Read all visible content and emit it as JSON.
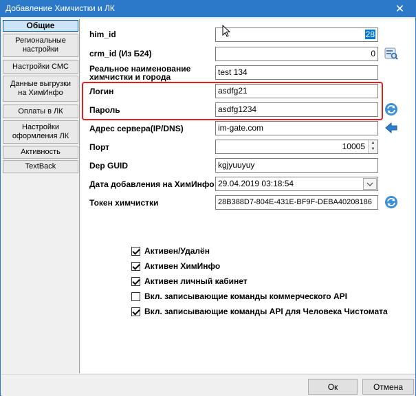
{
  "window": {
    "title": "Добавление Химчистки и ЛК",
    "close_glyph": "✕"
  },
  "sidebar": {
    "items": [
      {
        "label": "Общие",
        "active": true
      },
      {
        "label": "Региональные настройки",
        "active": false
      },
      {
        "label": "Настройки СМС",
        "active": false
      },
      {
        "label": "Данные выгрузки на ХимИнфо",
        "active": false
      },
      {
        "label": "Оплаты в ЛК",
        "active": false
      },
      {
        "label": "Настройки оформления ЛК",
        "active": false
      },
      {
        "label": "Активность",
        "active": false
      },
      {
        "label": "TextBack",
        "active": false
      }
    ]
  },
  "form": {
    "him_id": {
      "label": "him_id",
      "value": "28"
    },
    "crm_id": {
      "label": "crm_id (Из Б24)",
      "value": "0"
    },
    "real_name": {
      "label": "Реальное наименование химчистки и города",
      "value": "test 134"
    },
    "login": {
      "label": "Логин",
      "value": "asdfg21"
    },
    "password": {
      "label": "Пароль",
      "value": "asdfg1234"
    },
    "server": {
      "label": "Адрес сервера(IP/DNS)",
      "value": "im-gate.com"
    },
    "port": {
      "label": "Порт",
      "value": "10005"
    },
    "dep_guid": {
      "label": "Dep GUID",
      "value": "kgjyuuyuy"
    },
    "date_added": {
      "label": "Дата добавления на ХимИнфо",
      "value": "29.04.2019 03:18:54"
    },
    "token": {
      "label": "Токен химчистки",
      "value": "28B388D7-804E-431E-BF9F-DEBA40208186"
    }
  },
  "checkboxes": [
    {
      "label": "Активен/Удалён",
      "checked": true
    },
    {
      "label": "Активен ХимИнфо",
      "checked": true
    },
    {
      "label": "Активен личный кабинет",
      "checked": true
    },
    {
      "label": "Вкл. записывающие команды коммерческого API",
      "checked": false
    },
    {
      "label": "Вкл. записывающие команды API для Человека Чистомата",
      "checked": true
    }
  ],
  "footer": {
    "ok_label": "Ок",
    "cancel_label": "Отмена"
  },
  "colors": {
    "titlebar": "#2b79c8",
    "highlight": "#e02020",
    "selection": "#0078d7"
  }
}
